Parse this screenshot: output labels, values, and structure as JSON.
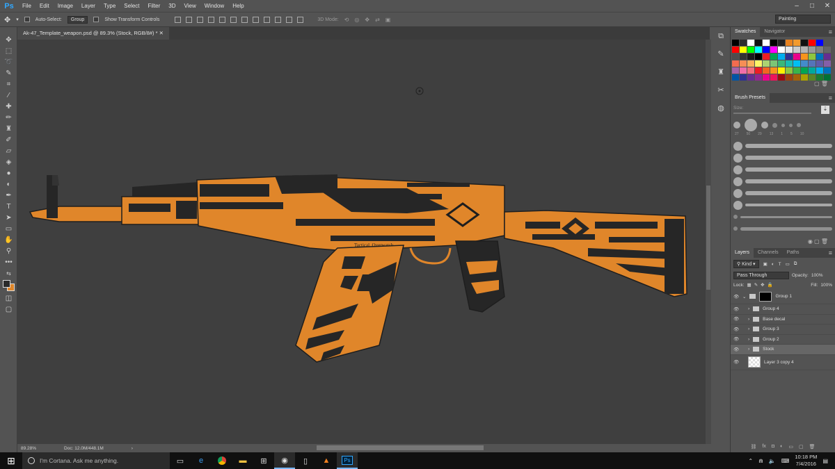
{
  "app": {
    "logo": "Ps"
  },
  "menu": [
    "File",
    "Edit",
    "Image",
    "Layer",
    "Type",
    "Select",
    "Filter",
    "3D",
    "View",
    "Window",
    "Help"
  ],
  "options": {
    "auto_select_label": "Auto-Select:",
    "auto_select_value": "Group",
    "transform_label": "Show Transform Controls",
    "mode_3d_label": "3D Mode:",
    "workspace": "Painting"
  },
  "document": {
    "tab_title": "Ak-47_Template_weapon.psd @ 89.3% (Stock, RGB/8#) *",
    "zoom": "89.28%",
    "doc_size": "Doc: 12.0M/448.1M",
    "decal_text": "Tactical_Overwatch"
  },
  "colors": {
    "orange": "#e0862a",
    "dark": "#2a2a2a",
    "canvas": "#3f3f3f"
  },
  "swatches_panel": {
    "tabs": [
      "Swatches",
      "Navigator"
    ],
    "colors": [
      "#000000",
      "#2e2e2e",
      "#ffffff",
      "#111111",
      "#ffffff",
      "#000000",
      "#222222",
      "#e8821e",
      "#f29a2e",
      "#111111",
      "#ff0000",
      "#0000ff",
      "#535353",
      "#ff0000",
      "#ffff00",
      "#00ff00",
      "#00ffff",
      "#0000ff",
      "#ff00ff",
      "#ffffff",
      "#e6e6e6",
      "#cccccc",
      "#b3b3b3",
      "#999999",
      "#808080",
      "#666666",
      "#4d4d4d",
      "#333333",
      "#1a1a1a",
      "#000000",
      "#ed1c24",
      "#00a651",
      "#00aeef",
      "#2e3192",
      "#ec008c",
      "#f7941d",
      "#8dc63f",
      "#0072bc",
      "#662d91",
      "#f26c4f",
      "#f68e56",
      "#fbaf5c",
      "#fff467",
      "#acd372",
      "#7cc576",
      "#3bb878",
      "#1abbb4",
      "#00bff3",
      "#438ccb",
      "#5574b9",
      "#605ca8",
      "#855fa8",
      "#a763a8",
      "#f06eaa",
      "#f26d7d",
      "#ed1c24",
      "#f26522",
      "#f7941d",
      "#fff200",
      "#8dc73f",
      "#39b54a",
      "#00a651",
      "#00a99d",
      "#00aeef",
      "#0072bc",
      "#0054a6",
      "#2e3192",
      "#662d91",
      "#92278f",
      "#ec008c",
      "#ed145b",
      "#9e0b0f",
      "#a0410d",
      "#a3620a",
      "#aba000",
      "#598527",
      "#1a7b30",
      "#007236"
    ]
  },
  "brush_presets": {
    "title": "Brush Presets",
    "size_label": "Size:",
    "tip_numbers": [
      "27",
      "50",
      "29",
      "13",
      "1",
      "5",
      "10"
    ]
  },
  "layers_panel": {
    "tabs": [
      "Layers",
      "Channels",
      "Paths"
    ],
    "kind_label": "Kind",
    "blend_mode": "Pass Through",
    "opacity_label": "Opacity:",
    "opacity_value": "100%",
    "lock_label": "Lock:",
    "fill_label": "Fill:",
    "fill_value": "100%",
    "layers": [
      {
        "name": "Group 1",
        "selected": false
      },
      {
        "name": "Group 4",
        "selected": false
      },
      {
        "name": "Base decal",
        "selected": false
      },
      {
        "name": "Group 3",
        "selected": false
      },
      {
        "name": "Group 2",
        "selected": false
      },
      {
        "name": "Stock",
        "selected": true
      },
      {
        "name": "Layer 3 copy 4",
        "selected": false
      }
    ]
  },
  "taskbar": {
    "search_placeholder": "I'm Cortana. Ask me anything.",
    "time": "10:18 PM",
    "date": "7/4/2016",
    "ps_label": "Ps"
  }
}
